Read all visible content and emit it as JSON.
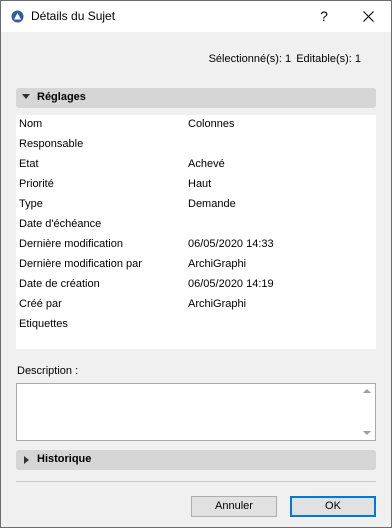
{
  "window": {
    "title": "Détails du Sujet",
    "help_label": "?"
  },
  "status": {
    "selected": "Sélectionné(s): 1",
    "editable": "Editable(s): 1"
  },
  "settings_section": {
    "label": "Réglages",
    "expanded": true
  },
  "properties": [
    {
      "name": "Nom",
      "value": "Colonnes"
    },
    {
      "name": "Responsable",
      "value": ""
    },
    {
      "name": "Etat",
      "value": "Achevé"
    },
    {
      "name": "Priorité",
      "value": "Haut"
    },
    {
      "name": "Type",
      "value": "Demande"
    },
    {
      "name": "Date d'échéance",
      "value": ""
    },
    {
      "name": "Dernière modification",
      "value": "06/05/2020 14:33"
    },
    {
      "name": "Dernière modification par",
      "value": "ArchiGraphi"
    },
    {
      "name": "Date de création",
      "value": "06/05/2020 14:19"
    },
    {
      "name": "Créé par",
      "value": "ArchiGraphi"
    },
    {
      "name": "Etiquettes",
      "value": ""
    }
  ],
  "description": {
    "label": "Description :",
    "value": ""
  },
  "history_section": {
    "label": "Historique",
    "expanded": false
  },
  "buttons": {
    "cancel": "Annuler",
    "ok": "OK"
  },
  "colors": {
    "section_header_bg": "#d6d6d6",
    "dialog_bg": "#f0f0f0",
    "ok_border": "#0078d7",
    "app_icon": "#2f5f9e"
  },
  "icons": {
    "app": "archicad-app-icon",
    "close": "close-icon",
    "expanded": "triangle-down-icon",
    "collapsed": "triangle-right-icon"
  }
}
